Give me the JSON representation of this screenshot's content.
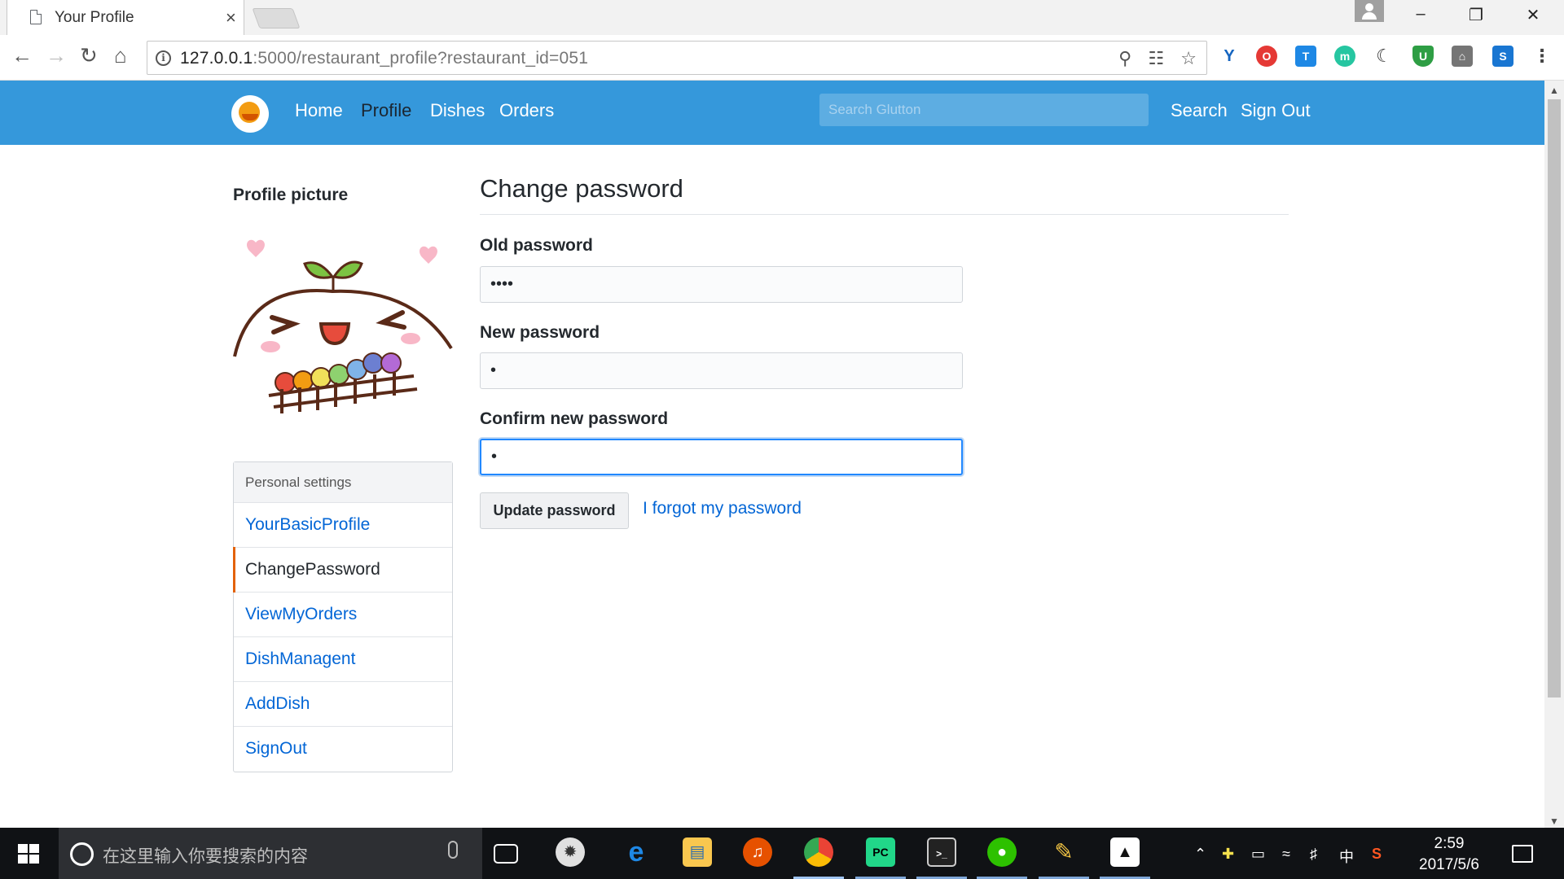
{
  "browser": {
    "tab_title": "Your Profile",
    "tab_close": "×",
    "url_host": "127.0.0.1",
    "url_rest": ":5000/restaurant_profile?restaurant_id=051",
    "info_glyph": "i",
    "extensions": [
      "Y",
      "O",
      "T",
      "m",
      "☾",
      "U",
      "⌂",
      "S",
      "⋮"
    ]
  },
  "navbar": {
    "links": [
      "Home",
      "Profile",
      "Dishes",
      "Orders"
    ],
    "active": "Profile",
    "search_placeholder": "Search Glutton",
    "search_label": "Search",
    "signout_label": "Sign Out",
    "color": "#3598db"
  },
  "sidebar": {
    "profile_picture_title": "Profile picture",
    "settings_header": "Personal settings",
    "items": [
      {
        "label": "YourBasicProfile",
        "selected": false
      },
      {
        "label": "ChangePassword",
        "selected": true
      },
      {
        "label": "ViewMyOrders",
        "selected": false
      },
      {
        "label": "DishManagent",
        "selected": false
      },
      {
        "label": "AddDish",
        "selected": false
      },
      {
        "label": "SignOut",
        "selected": false
      }
    ]
  },
  "form": {
    "title": "Change password",
    "old_label": "Old password",
    "old_value": "1234",
    "new_label": "New password",
    "new_value": "1",
    "confirm_label": "Confirm new password",
    "confirm_value": "1",
    "submit_label": "Update password",
    "forgot_label": "I forgot my password"
  },
  "taskbar": {
    "search_placeholder": "在这里输入你要搜索的内容",
    "ime": "中",
    "time": "2:59",
    "date": "2017/5/6"
  }
}
